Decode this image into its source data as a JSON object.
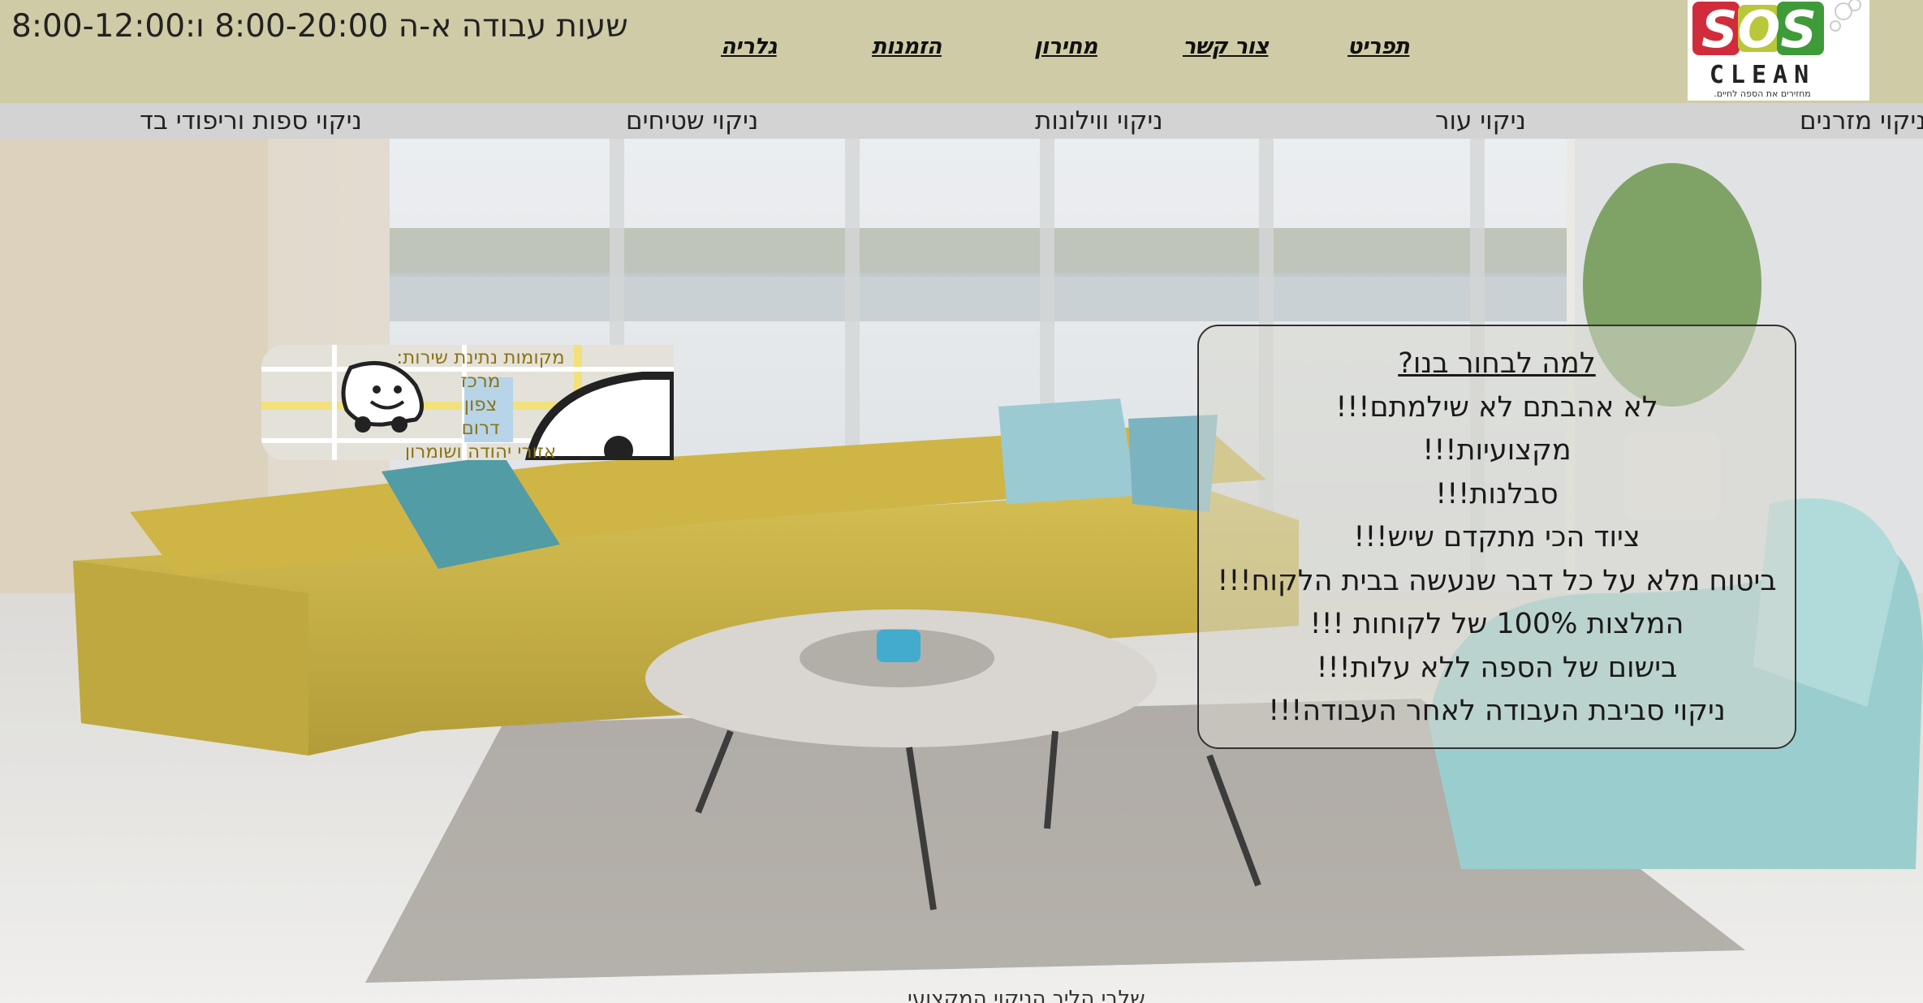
{
  "header": {
    "work_hours": "שעות עבודה א-ה 8:00-20:00 ו:8:00-12:00",
    "nav": [
      {
        "label": "תפריט"
      },
      {
        "label": "צור קשר"
      },
      {
        "label": "מחירון"
      },
      {
        "label": "הזמנות"
      },
      {
        "label": "גלריה"
      }
    ],
    "logo": {
      "text": "SOS",
      "sub": "CLEAN",
      "tagline": "מחזירים את הספה לחיים."
    }
  },
  "services": [
    {
      "label": "ניקוי מזרנים"
    },
    {
      "label": "ניקוי עור"
    },
    {
      "label": "ניקוי ווילונות"
    },
    {
      "label": "ניקוי שטיחים"
    },
    {
      "label": "ניקוי ספות וריפודי בד"
    }
  ],
  "why_us": {
    "title": "למה לבחור בנו?",
    "items": [
      "לא אהבתם לא שילמתם!!!",
      "מקצועיות!!!",
      "סבלנות!!!",
      "ציוד הכי מתקדם שיש!!!",
      "ביטוח מלא על כל דבר שנעשה בבית הלקוח!!!",
      "המלצות 100% של לקוחות !!!",
      "בישום של הספה ללא עלות!!!",
      "ניקוי סביבת העבודה לאחר העבודה!!!"
    ]
  },
  "waze": {
    "title": "מקומות נתינת שירות:",
    "areas": [
      "מרכז",
      "צפון",
      "דרום",
      "אזורי יהודה ושומרון"
    ]
  },
  "footer": {
    "text": "שלבי הליך הניקוי המקצועי"
  }
}
